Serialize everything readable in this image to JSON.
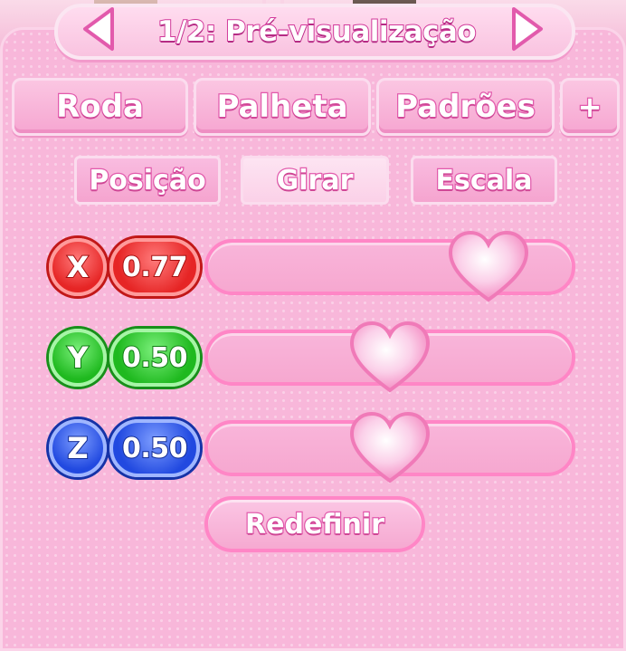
{
  "header": {
    "title": "1/2: Pré-visualização",
    "prev_icon": "chevron-left-icon",
    "next_icon": "chevron-right-icon"
  },
  "tabs": [
    {
      "label": "Roda"
    },
    {
      "label": "Palheta"
    },
    {
      "label": "Padrões"
    },
    {
      "label": "+"
    }
  ],
  "subtabs": [
    {
      "label": "Posição"
    },
    {
      "label": "Girar",
      "selected": true
    },
    {
      "label": "Escala"
    }
  ],
  "sliders": [
    {
      "axis": "X",
      "value_text": "0.77",
      "value": 0.77,
      "color": "#e62525"
    },
    {
      "axis": "Y",
      "value_text": "0.50",
      "value": 0.5,
      "color": "#1fb91f"
    },
    {
      "axis": "Z",
      "value_text": "0.50",
      "value": 0.5,
      "color": "#2149e0"
    }
  ],
  "reset_label": "Redefinir",
  "colors": {
    "accent": "#ff86c6",
    "background": "#f8b7da"
  }
}
